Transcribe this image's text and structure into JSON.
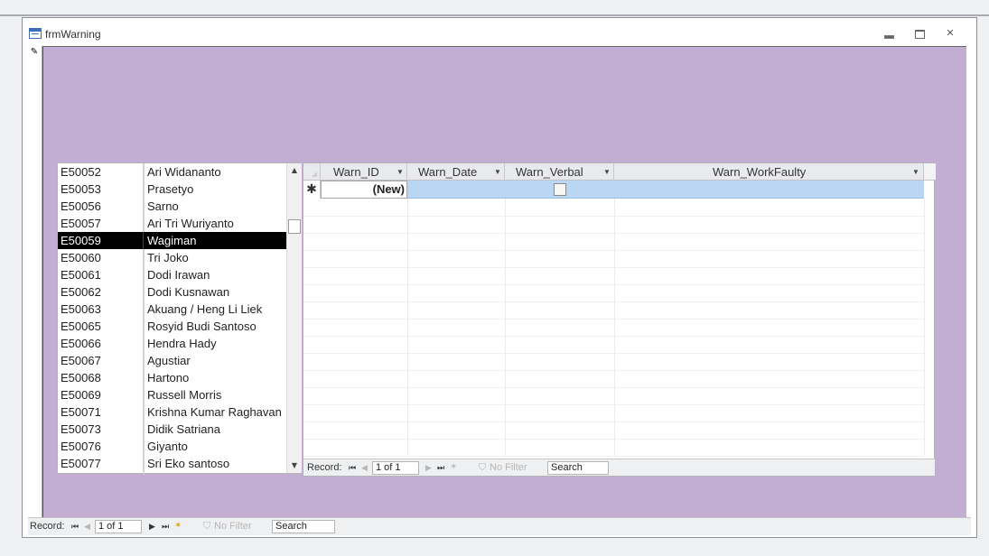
{
  "window": {
    "title": "frmWarning"
  },
  "employee_list": {
    "rows": [
      {
        "id": "E50052",
        "name": "Ari Widananto"
      },
      {
        "id": "E50053",
        "name": "Prasetyo"
      },
      {
        "id": "E50056",
        "name": "Sarno"
      },
      {
        "id": "E50057",
        "name": "Ari Tri Wuriyanto"
      },
      {
        "id": "E50059",
        "name": "Wagiman"
      },
      {
        "id": "E50060",
        "name": "Tri Joko"
      },
      {
        "id": "E50061",
        "name": "Dodi Irawan"
      },
      {
        "id": "E50062",
        "name": "Dodi Kusnawan"
      },
      {
        "id": "E50063",
        "name": "Akuang / Heng Li Liek"
      },
      {
        "id": "E50065",
        "name": "Rosyid Budi Santoso"
      },
      {
        "id": "E50066",
        "name": "Hendra Hady"
      },
      {
        "id": "E50067",
        "name": "Agustiar"
      },
      {
        "id": "E50068",
        "name": "Hartono"
      },
      {
        "id": "E50069",
        "name": "Russell Morris"
      },
      {
        "id": "E50071",
        "name": "Krishna Kumar Raghavan"
      },
      {
        "id": "E50073",
        "name": "Didik Satriana"
      },
      {
        "id": "E50076",
        "name": "Giyanto"
      },
      {
        "id": "E50077",
        "name": "Sri Eko santoso"
      }
    ],
    "selected_id": "E50059"
  },
  "datasheet": {
    "columns": [
      "Warn_ID",
      "Warn_Date",
      "Warn_Verbal",
      "Warn_WorkFaulty"
    ],
    "new_row_marker": "✱",
    "new_row_id": "(New)",
    "new_row_verbal_checked": false
  },
  "subform_nav": {
    "record_label": "Record:",
    "position": "1 of 1",
    "filter_label": "No Filter",
    "search_placeholder": "Search"
  },
  "form_nav": {
    "record_label": "Record:",
    "position": "1 of 1",
    "filter_label": "No Filter",
    "search_placeholder": "Search"
  },
  "icons": {
    "window_minimize": "minimize-icon",
    "window_restore": "restore-icon",
    "window_close": "close-icon",
    "record_selector": "pencil-icon",
    "nav_first": "first-record-icon",
    "nav_prev": "previous-record-icon",
    "nav_next": "next-record-icon",
    "nav_last": "last-record-icon",
    "nav_new": "new-record-icon",
    "filter": "filter-icon"
  },
  "colors": {
    "form_background": "#c3aed3",
    "selected_row": "#000000",
    "new_row_highlight": "#b9d6f3"
  }
}
